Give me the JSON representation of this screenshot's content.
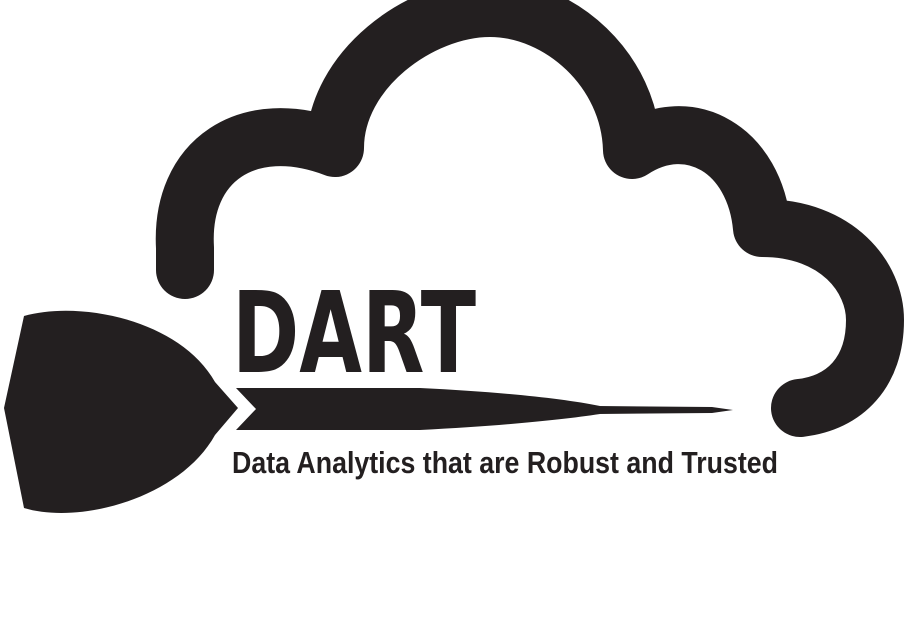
{
  "logo": {
    "title": "DART",
    "tagline": "Data Analytics that are Robust and Trusted",
    "ink_color": "#231f20",
    "background_color": "#ffffff"
  }
}
